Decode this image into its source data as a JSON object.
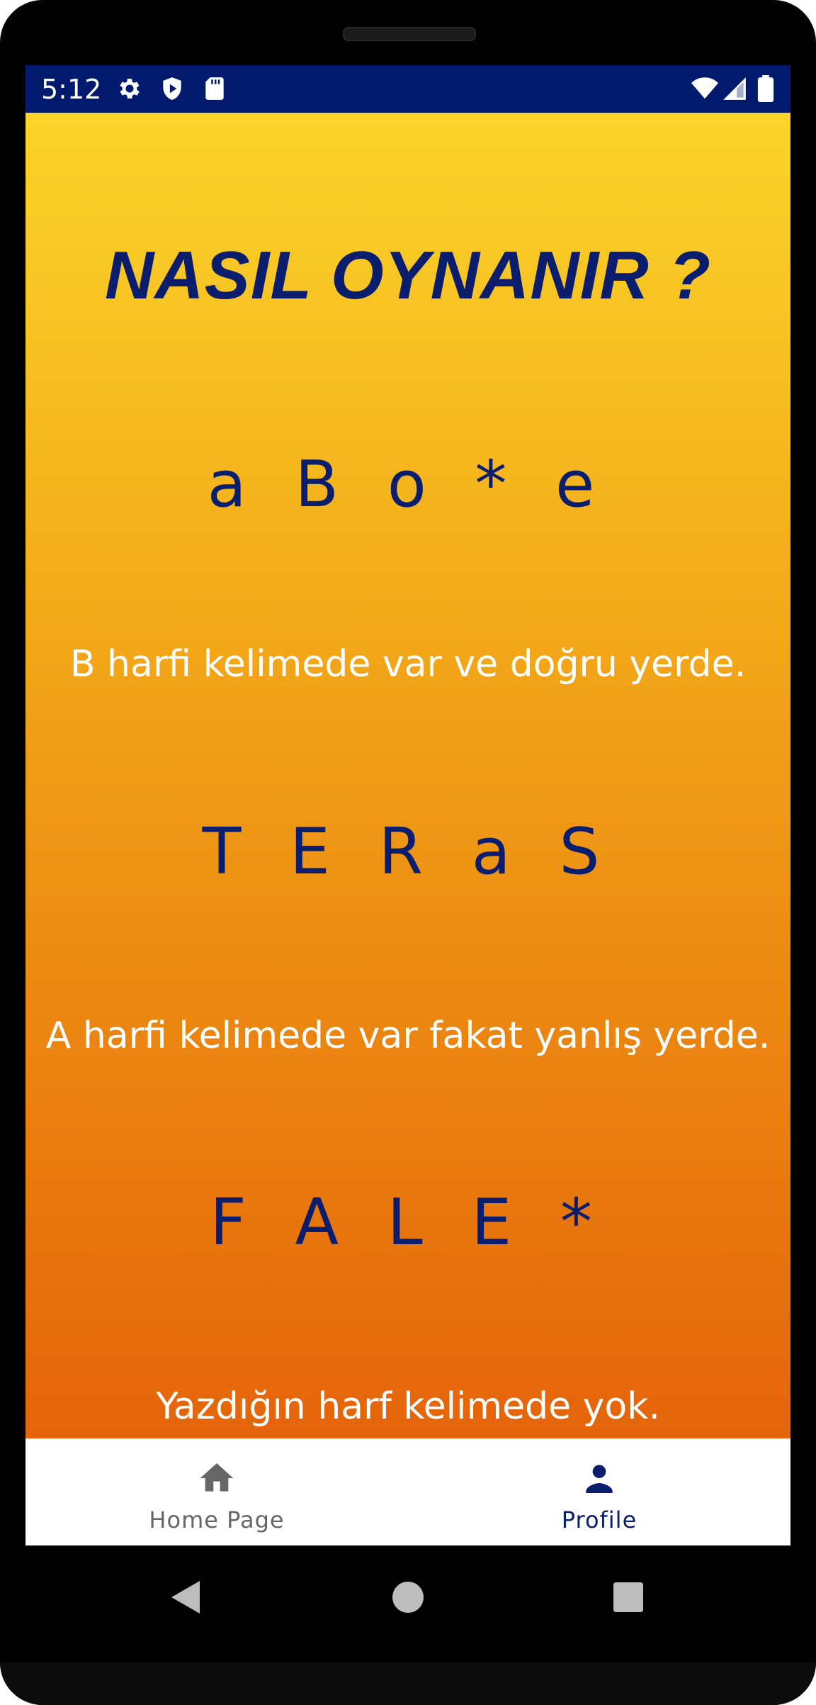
{
  "status_bar": {
    "time": "5:12",
    "left_icons": [
      "gear-icon",
      "shield-play-icon",
      "sd-card-icon"
    ],
    "right_icons": [
      "wifi-icon",
      "cell-signal-icon",
      "battery-icon"
    ],
    "background": "#011a6e"
  },
  "main": {
    "title": "NASIL OYNANIR ?",
    "examples": [
      {
        "word": "a B o * e",
        "hint": "B harfi kelimede var ve doğru yerde."
      },
      {
        "word": "T E R a S",
        "hint": "A harfi kelimede var fakat yanlış yerde."
      },
      {
        "word": "F A L E *",
        "hint": "Yazdığın harf kelimede yok."
      }
    ],
    "gradient_top": "#fbd42a",
    "gradient_bottom": "#e5640a",
    "text_color": "#0b1e6e"
  },
  "bottom_nav": {
    "items": [
      {
        "label": "Home Page",
        "icon": "home-icon",
        "active": false
      },
      {
        "label": "Profile",
        "icon": "person-icon",
        "active": true
      }
    ],
    "active_color": "#0b1e6e",
    "inactive_color": "#666666"
  },
  "system_nav": {
    "buttons": [
      "back-icon",
      "home-circle-icon",
      "recents-icon"
    ]
  }
}
